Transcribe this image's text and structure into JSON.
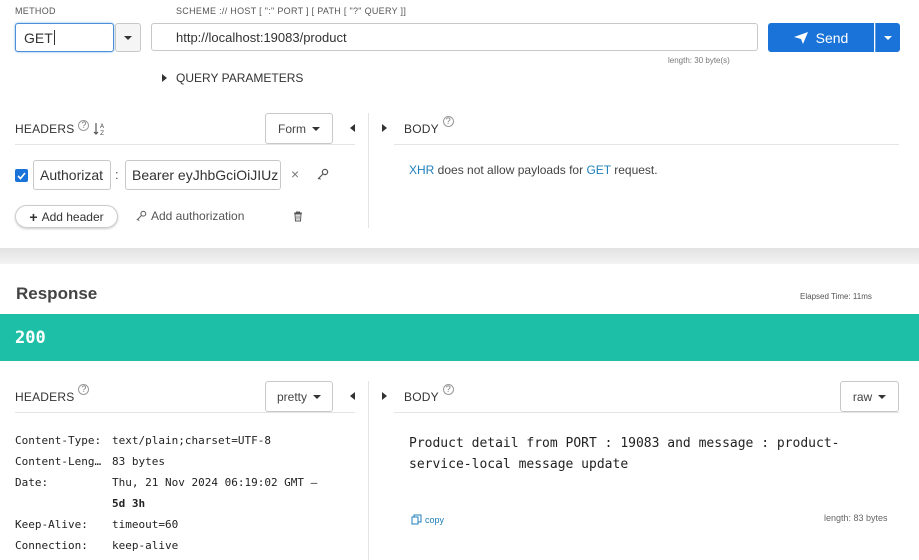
{
  "request": {
    "method_label": "METHOD",
    "method_value": "GET",
    "scheme_label": "SCHEME :// HOST [ \":\" PORT ] [ PATH [ \"?\" QUERY ]]",
    "url_value": "http://localhost:19083/product",
    "url_length": "length: 30 byte(s)",
    "send_label": "Send",
    "query_params_label": "QUERY PARAMETERS",
    "headers_title": "HEADERS",
    "headers_mode": "Form",
    "body_title": "BODY",
    "header_row": {
      "checked": true,
      "name": "Authorizat",
      "separator": ":",
      "value": "Bearer eyJhbGciOiJIUz"
    },
    "add_header_label": "Add header",
    "add_authorization_label": "Add authorization",
    "body_message_xhr": "XHR",
    "body_message_mid": " does not allow payloads for ",
    "body_message_method": "GET",
    "body_message_end": " request."
  },
  "response": {
    "title": "Response",
    "elapsed": "Elapsed Time: 11ms",
    "status_code": "200",
    "status_color": "#1dc0a6",
    "headers_title": "HEADERS",
    "headers_mode": "pretty",
    "body_title": "BODY",
    "body_mode": "raw",
    "headers": [
      {
        "name": "Content-Type:",
        "value": "text/plain;charset=UTF-8",
        "extra": ""
      },
      {
        "name": "Content-Leng…",
        "value": "83 bytes",
        "extra": ""
      },
      {
        "name": "Date:",
        "value": "Thu, 21 Nov 2024 06:19:02 GMT –",
        "extra": "5d 3h"
      },
      {
        "name": "Keep-Alive:",
        "value": "timeout=60",
        "extra": ""
      },
      {
        "name": "Connection:",
        "value": "keep-alive",
        "extra": ""
      }
    ],
    "body_line1": "Product detail from PORT : 19083 and message : product-",
    "body_line2": "service-local message update",
    "copy_label": "copy",
    "body_length": "length: 83 bytes"
  },
  "colors": {
    "accent": "#1a73d9",
    "status_green": "#1dc0a6",
    "link": "#1f7fba"
  }
}
